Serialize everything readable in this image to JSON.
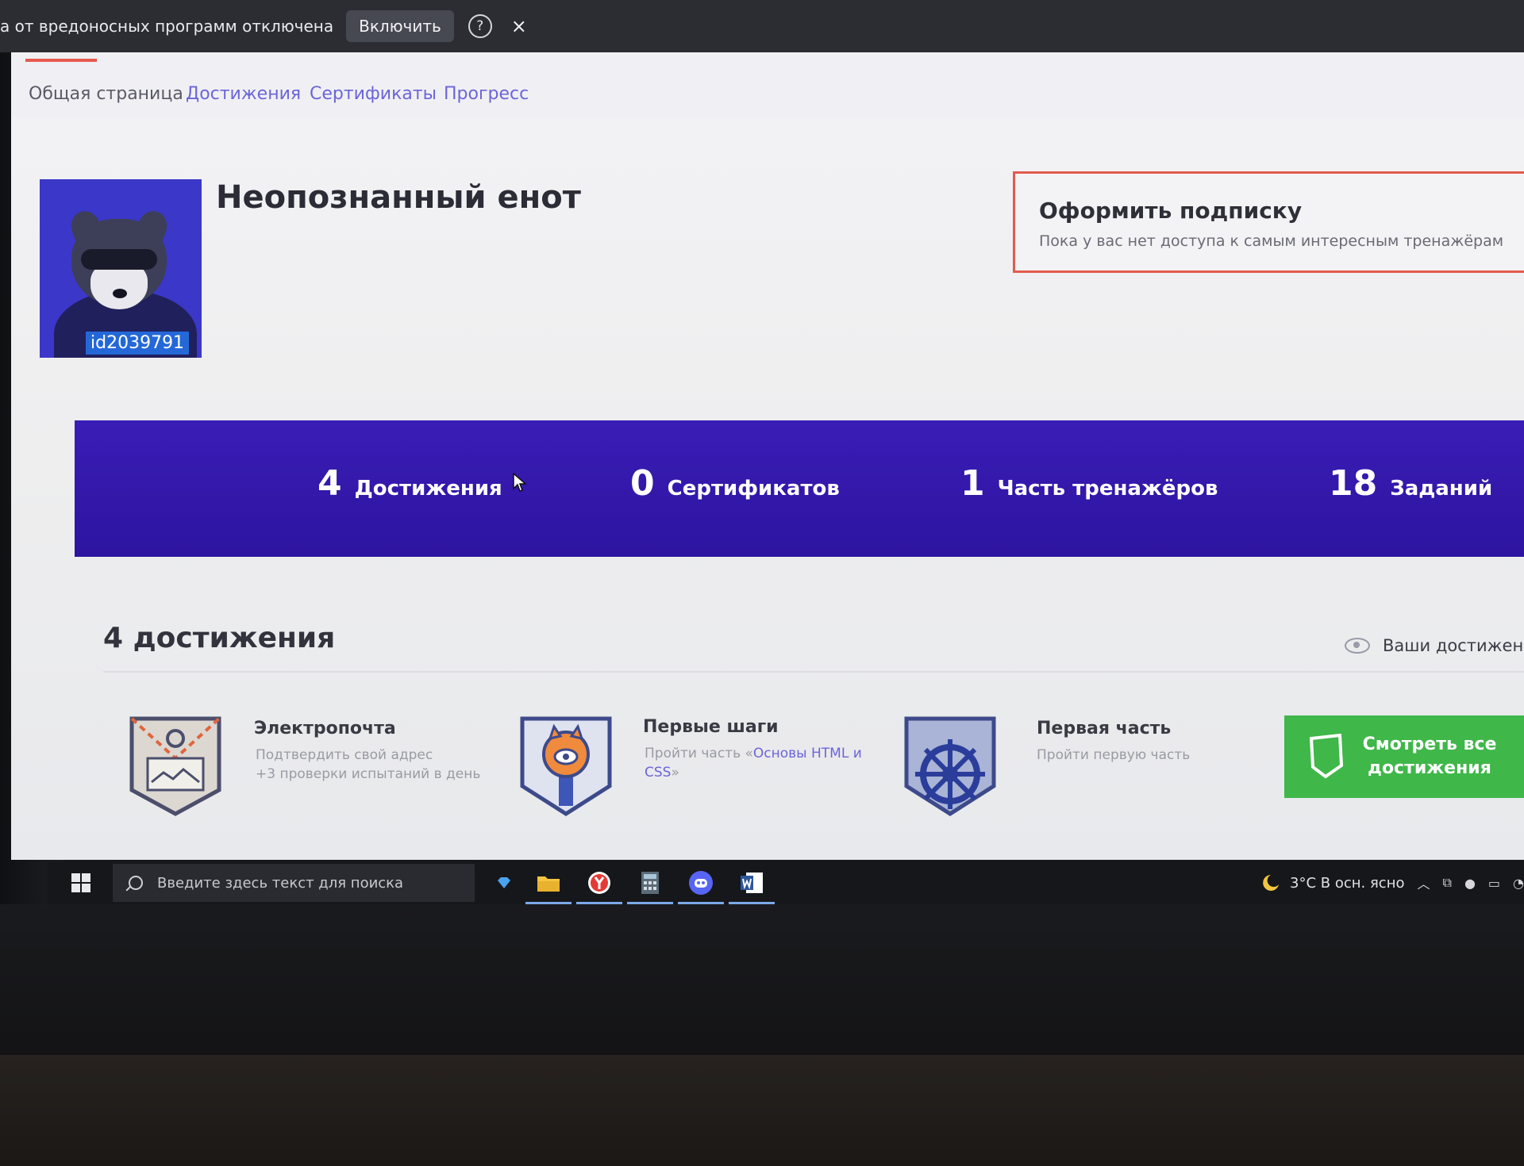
{
  "notification": {
    "text": "а от вредоносных программ отключена",
    "enable_label": "Включить",
    "help_label": "?",
    "close_label": "×"
  },
  "tabs": [
    {
      "label": "Общая страница"
    },
    {
      "label": "Достижения"
    },
    {
      "label": "Сертификаты"
    },
    {
      "label": "Прогресс"
    }
  ],
  "profile": {
    "name": "Неопознанный енот",
    "id_label": "id2039791"
  },
  "subscription": {
    "title": "Оформить подписку",
    "subtitle": "Пока у вас нет доступа к самым интересным тренажёрам"
  },
  "stats": [
    {
      "value": "4",
      "label": "Достижения"
    },
    {
      "value": "0",
      "label": "Сертификатов"
    },
    {
      "value": "1",
      "label": "Часть тренажёров"
    },
    {
      "value": "18",
      "label": "Заданий"
    }
  ],
  "achievements": {
    "heading": "4 достижения",
    "visibility_label": "Ваши достижени",
    "items": [
      {
        "title": "Электропочта",
        "desc_line1": "Подтвердить свой адрес",
        "desc_line2": "+3 проверки испытаний в день"
      },
      {
        "title": "Первые шаги",
        "desc_prefix": "Пройти часть «",
        "desc_link": "Основы HTML и CSS",
        "desc_suffix": "»"
      },
      {
        "title": "Первая часть",
        "desc_line1": "Пройти первую часть"
      }
    ],
    "see_all_label": "Смотреть все достижения"
  },
  "taskbar": {
    "search_placeholder": "Введите здесь текст для поиска",
    "weather": "3°C  В осн. ясно",
    "apps": [
      "file-explorer",
      "yandex-browser",
      "calculator",
      "discord",
      "word"
    ]
  },
  "colors": {
    "accent": "#6b65d8",
    "stats_band": "#3218a8",
    "subscribe_border": "#e35a4c",
    "see_all": "#3fb749",
    "avatar_bg": "#3b37c8"
  }
}
